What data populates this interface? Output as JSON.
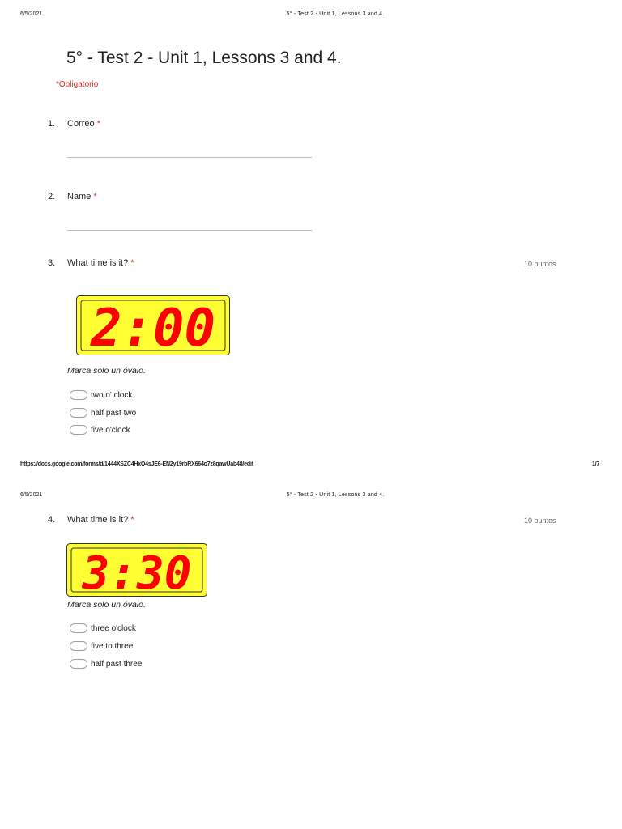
{
  "pages": [
    {
      "date": "6/5/2021",
      "title": "5° - Test 2 - Unit 1, Lessons 3 and 4."
    },
    {
      "date": "6/5/2021",
      "title": "5° - Test 2 - Unit 1, Lessons 3 and 4."
    }
  ],
  "footer": {
    "url": "https://docs.google.com/forms/d/1444XSZC4HxO4sJE6-EN2y19rbRX664o7z8qawUab48/edit",
    "page_num": "1/7"
  },
  "form": {
    "title": "5° - Test 2 - Unit 1, Lessons 3 and 4.",
    "required_note": "*Obligatorio"
  },
  "questions": [
    {
      "num": "1.",
      "text": "Correo",
      "required_mark": "*"
    },
    {
      "num": "2.",
      "text": "Name",
      "required_mark": "*"
    },
    {
      "num": "3.",
      "text": "What time is it?",
      "required_mark": "*",
      "points": "10 puntos",
      "clock_time": "2:00",
      "instruction": "Marca solo un óvalo.",
      "options": [
        "two o' clock",
        "half past two",
        "five o'clock"
      ]
    },
    {
      "num": "4.",
      "text": "What time is it?",
      "required_mark": "*",
      "points": "10 puntos",
      "clock_time": "3:30",
      "instruction": "Marca solo un óvalo.",
      "options": [
        "three o'clock",
        "five to three",
        "half past three"
      ]
    }
  ],
  "colors": {
    "required": "#d93025",
    "clock_face": "#ffff33",
    "clock_digits": "#ff0000"
  }
}
